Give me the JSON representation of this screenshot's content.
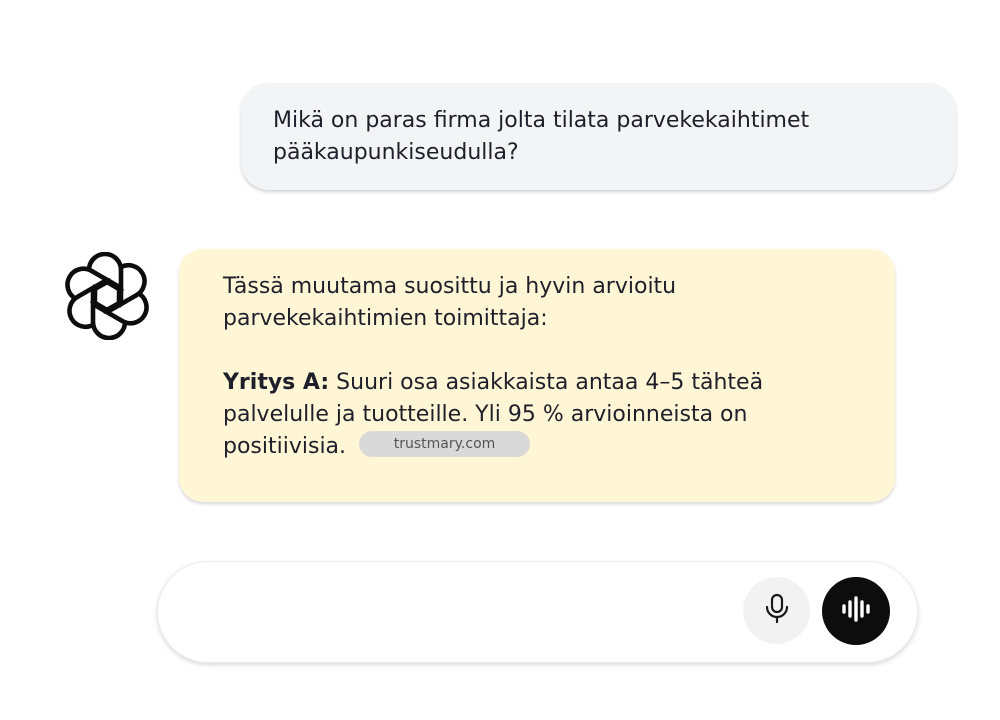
{
  "user_message": {
    "text": "Mikä on paras firma jolta tilata parvekekaihtimet pääkaupunkiseudulla?"
  },
  "assistant_message": {
    "avatar_icon": "openai-logo-icon",
    "intro": "Tässä muutama suosittu ja hyvin arvioitu parvekekaihtimien toimittaja:",
    "company_label": "Yritys A:",
    "company_text": "Suuri osa asiakkaista antaa 4–5 tähteä palvelulle ja tuotteille. Yli 95 % arvioinneista on positiivisia.",
    "source_chip": "trustmary.com"
  },
  "composer": {
    "mic_icon": "microphone-icon",
    "voice_icon": "voice-waveform-icon"
  },
  "colors": {
    "user_bubble": "#f3f4f6",
    "assistant_bubble": "#fef6d5",
    "chip": "#d9d9d9",
    "voice_button": "#0d0d0d"
  }
}
